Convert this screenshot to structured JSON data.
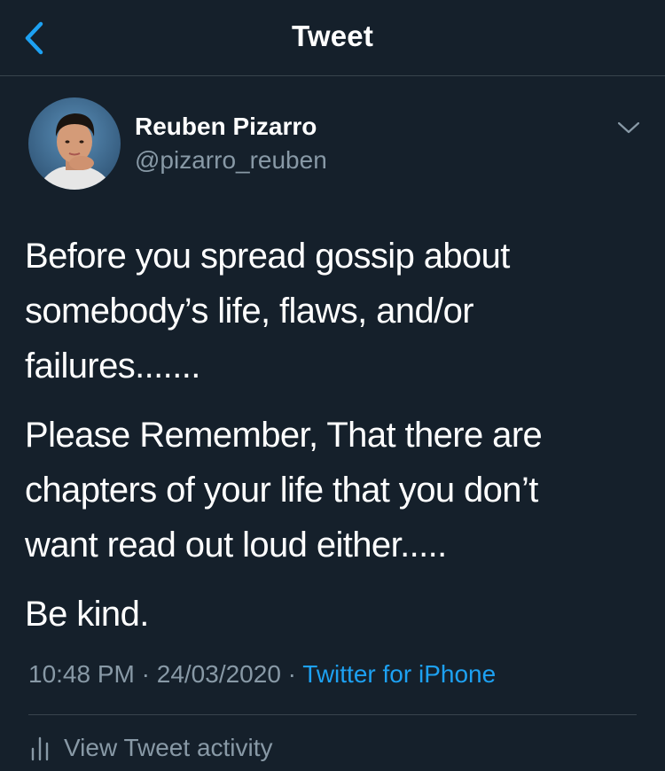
{
  "nav": {
    "title": "Tweet",
    "back_icon": "chevron-left-icon"
  },
  "tweet": {
    "author": {
      "name": "Reuben Pizarro",
      "handle": "@pizarro_reuben"
    },
    "menu_icon": "chevron-down-icon",
    "paragraphs": [
      "Before you spread gossip about\nsomebody’s life, flaws, and/or\nfailures.......",
      "Please Remember, That there are\nchapters of your life that you don’t\nwant read out loud either.....",
      "Be kind."
    ],
    "time": "10:48 PM",
    "date": "24/03/2020",
    "separator": "·",
    "source": "Twitter for iPhone",
    "activity_label": "View Tweet activity",
    "activity_icon": "bar-chart-icon"
  },
  "colors": {
    "background": "#15202b",
    "text": "#ffffff",
    "secondary": "#8899a6",
    "accent": "#1da1f2",
    "divider": "#38444d"
  }
}
